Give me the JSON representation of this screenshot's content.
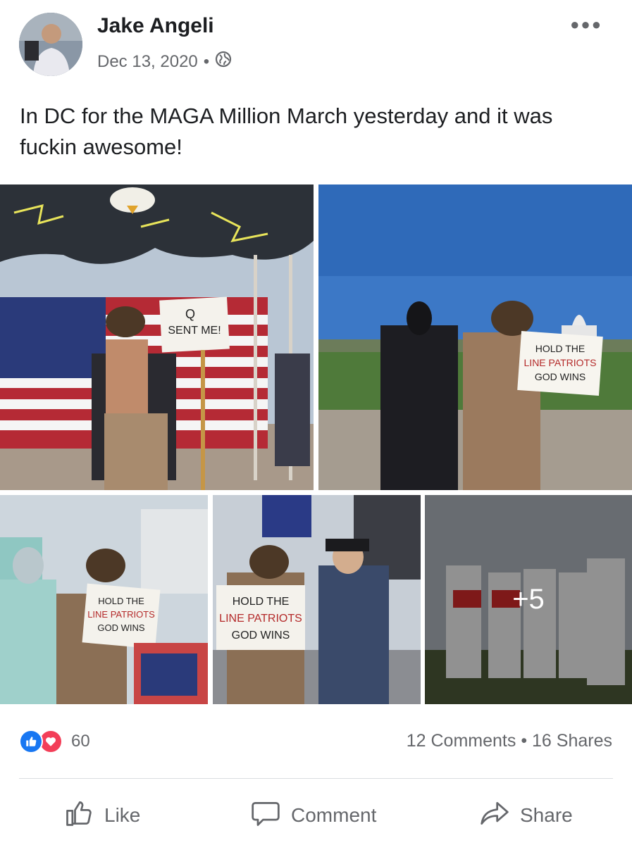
{
  "post": {
    "author": "Jake Angeli",
    "date": "Dec 13, 2020",
    "separator": "•",
    "text": "In DC for the MAGA Million March yesterday and it was fuckin awesome!"
  },
  "photos": {
    "p1_sign": [
      "Q",
      "SENT ME!"
    ],
    "p2_sign": [
      "HOLD THE",
      "LINE PATRIOTS",
      "GOD WINS"
    ],
    "p3_sign": [
      "HOLD THE",
      "LINE PATRIOTS",
      "GOD WINS"
    ],
    "p4_sign": [
      "HOLD THE",
      "LINE PATRIOTS",
      "GOD WINS"
    ],
    "more_count": "+5"
  },
  "stats": {
    "reaction_count": "60",
    "comments": "12 Comments",
    "dot": "•",
    "shares": "16 Shares"
  },
  "actions": {
    "like": "Like",
    "comment": "Comment",
    "share": "Share"
  },
  "icons": {
    "privacy": "globe-icon",
    "more": "ellipsis-icon",
    "like": "thumbs-up-icon",
    "comment": "speech-bubble-icon",
    "share": "share-arrow-icon"
  },
  "colors": {
    "like_blue": "#1877f2",
    "love_red": "#f33e58",
    "secondary_text": "#65676b"
  }
}
